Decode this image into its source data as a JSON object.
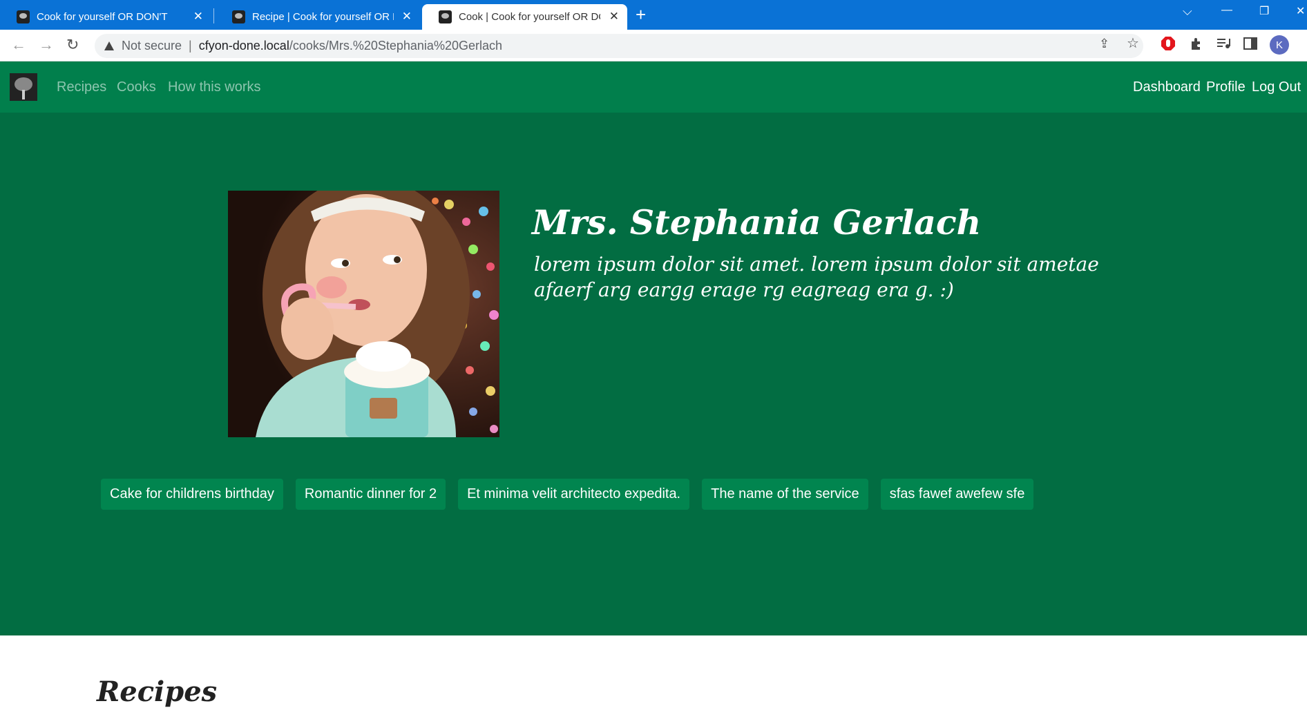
{
  "browser": {
    "tabs": [
      {
        "title": "Cook for yourself OR DON'T",
        "active": false
      },
      {
        "title": "Recipe | Cook for yourself OR DON'T",
        "active": false
      },
      {
        "title": "Cook | Cook for yourself OR DON'T",
        "active": true
      }
    ],
    "address": {
      "security": "Not secure",
      "host": "cfyon-done.local",
      "path": "/cooks/Mrs.%20Stephania%20Gerlach"
    },
    "profile_initial": "K"
  },
  "site_nav": {
    "left_links": [
      "Recipes",
      "Cooks",
      "How this works"
    ],
    "right_links": [
      "Dashboard",
      "Profile",
      "Log Out"
    ],
    "bg_color": "#017f4c"
  },
  "hero": {
    "bg_color": "#026d42",
    "name": "Mrs. Stephania Gerlach",
    "bio": "lorem ipsum dolor sit amet. lorem ipsum dolor sit ametae afaerf arg eargg erage rg eagreag era g. :)",
    "services": [
      "Cake for childrens birthday",
      "Romantic dinner for 2",
      "Et minima velit architecto expedita.",
      "The name of the service",
      "sfas fawef awefew sfe"
    ]
  },
  "sections": {
    "recipes_heading": "Recipes"
  }
}
